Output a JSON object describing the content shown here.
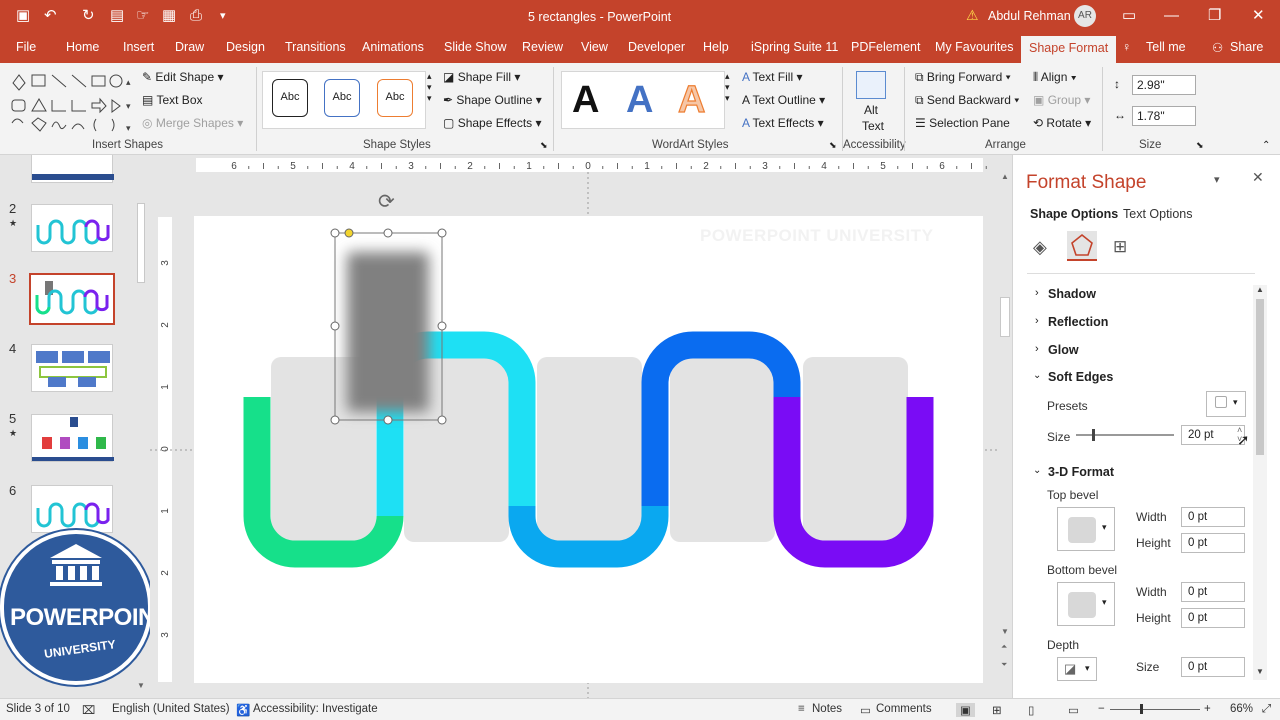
{
  "window": {
    "title": "5 rectangles  -  PowerPoint",
    "user_name": "Abdul Rehman",
    "user_initials": "AR",
    "accent_color": "#c4432b"
  },
  "tabs": [
    "File",
    "Home",
    "Insert",
    "Draw",
    "Design",
    "Transitions",
    "Animations",
    "Slide Show",
    "Review",
    "View",
    "Developer",
    "Help",
    "iSpring Suite 11",
    "PDFelement",
    "My Favourites",
    "Shape Format",
    "Tell me",
    "Share"
  ],
  "ribbon": {
    "insert_shapes": {
      "edit_shape": "Edit Shape",
      "text_box": "Text Box",
      "merge_shapes": "Merge Shapes",
      "label": "Insert Shapes"
    },
    "shape_styles": {
      "abc": "Abc",
      "shape_fill": "Shape Fill",
      "shape_outline": "Shape Outline",
      "shape_effects": "Shape Effects",
      "label": "Shape Styles"
    },
    "wordart": {
      "letter": "A",
      "text_fill": "Text Fill",
      "text_outline": "Text Outline",
      "text_effects": "Text Effects",
      "label": "WordArt Styles"
    },
    "accessibility": {
      "alt_text_1": "Alt",
      "alt_text_2": "Text",
      "label": "Accessibility"
    },
    "arrange": {
      "bring_forward": "Bring Forward",
      "send_backward": "Send Backward",
      "selection_pane": "Selection Pane",
      "align": "Align",
      "group": "Group",
      "rotate": "Rotate",
      "label": "Arrange"
    },
    "size": {
      "height": "2.98\"",
      "width": "1.78\"",
      "label": "Size"
    }
  },
  "slides_panel": {
    "numbers": [
      "2",
      "3",
      "4",
      "5",
      "6"
    ],
    "current": "3"
  },
  "slide": {
    "watermark": "POWERPOINT UNIVERSITY"
  },
  "ruler": {
    "h_ticks": [
      "6",
      "5",
      "4",
      "3",
      "2",
      "1",
      "0",
      "1",
      "2",
      "3",
      "4",
      "5",
      "6"
    ],
    "v_ticks": [
      "3",
      "2",
      "1",
      "0",
      "1",
      "2",
      "3"
    ]
  },
  "format_pane": {
    "title": "Format Shape",
    "tab_shape": "Shape Options",
    "tab_text": "Text Options",
    "sections": {
      "shadow": "Shadow",
      "reflection": "Reflection",
      "glow": "Glow",
      "soft_edges": "Soft Edges",
      "three_d": "3-D Format"
    },
    "presets_label": "Presets",
    "size_label": "Size",
    "soft_edge_size": "20 pt",
    "top_bevel": "Top bevel",
    "bottom_bevel": "Bottom bevel",
    "width_label": "Width",
    "height_label": "Height",
    "depth_label": "Depth",
    "zero": "0 pt"
  },
  "status": {
    "slide": "Slide 3 of 10",
    "language": "English (United States)",
    "accessibility": "Accessibility: Investigate",
    "notes": "Notes",
    "comments": "Comments",
    "zoom": "66%"
  },
  "logo": {
    "line1": "POWERPOINT",
    "line2": "UNIVERSITY"
  }
}
